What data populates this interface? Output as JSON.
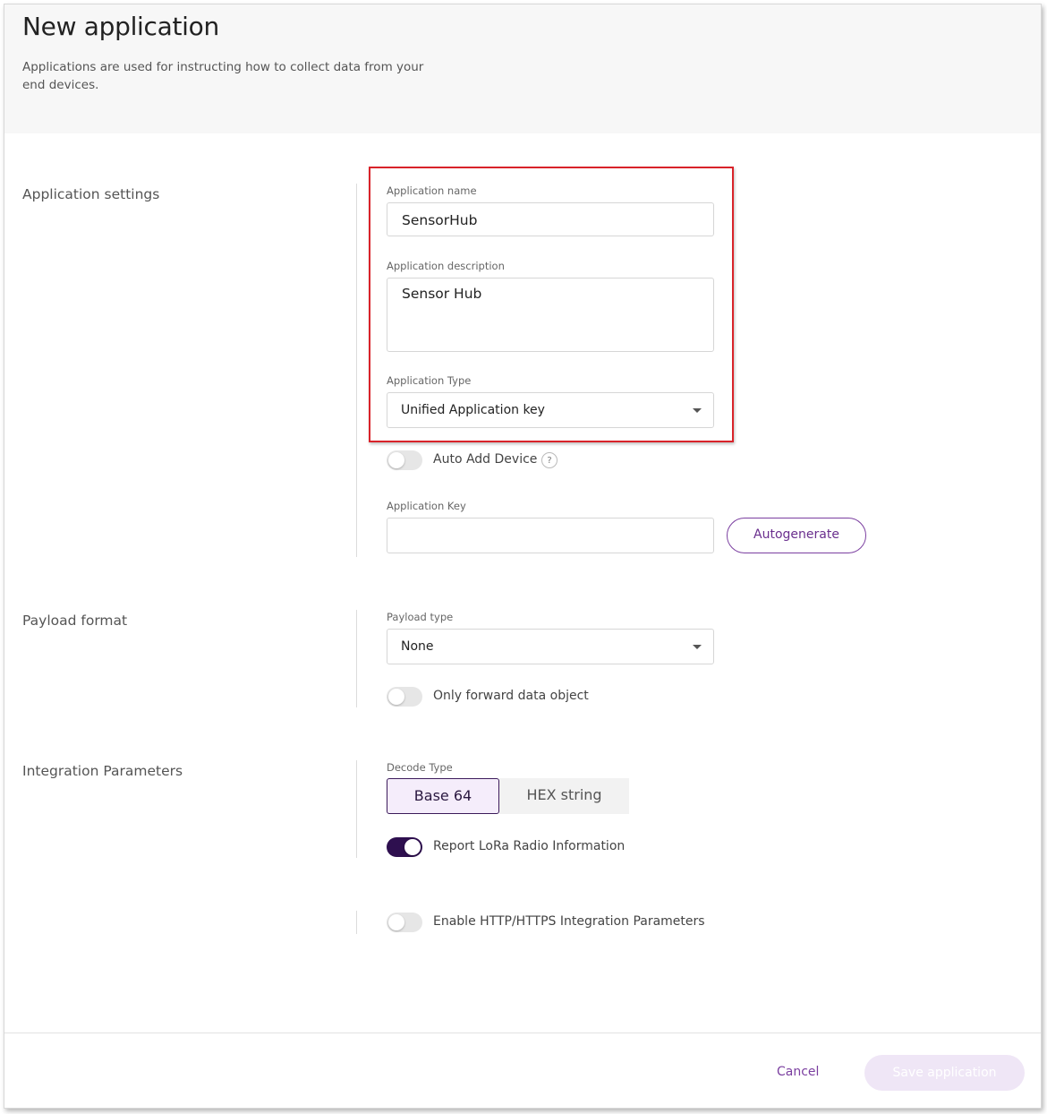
{
  "header": {
    "title": "New application",
    "subtitle": "Applications are used for instructing how to collect data from your end devices."
  },
  "sections": {
    "application_settings": "Application settings",
    "payload_format": "Payload format",
    "integration_parameters": "Integration Parameters"
  },
  "app_settings": {
    "name_label": "Application name",
    "name_value": "SensorHub",
    "description_label": "Application description",
    "description_value": "Sensor Hub",
    "type_label": "Application Type",
    "type_value": "Unified Application key",
    "auto_add_label": "Auto Add Device",
    "auto_add_on": false,
    "help_glyph": "?",
    "key_label": "Application Key",
    "key_value": "",
    "autogenerate_label": "Autogenerate"
  },
  "payload": {
    "type_label": "Payload type",
    "type_value": "None",
    "only_forward_label": "Only forward data object",
    "only_forward_on": false
  },
  "integration": {
    "decode_label": "Decode Type",
    "decode_options": [
      "Base 64",
      "HEX string"
    ],
    "decode_selected": "Base 64",
    "report_lora_label": "Report LoRa Radio Information",
    "report_lora_on": true,
    "enable_http_label": "Enable HTTP/HTTPS Integration Parameters",
    "enable_http_on": false
  },
  "footer": {
    "cancel_label": "Cancel",
    "save_label": "Save application"
  },
  "colors": {
    "accent": "#7b3fa0",
    "toggle_on": "#2e0f4f",
    "highlight": "#d9232a"
  }
}
